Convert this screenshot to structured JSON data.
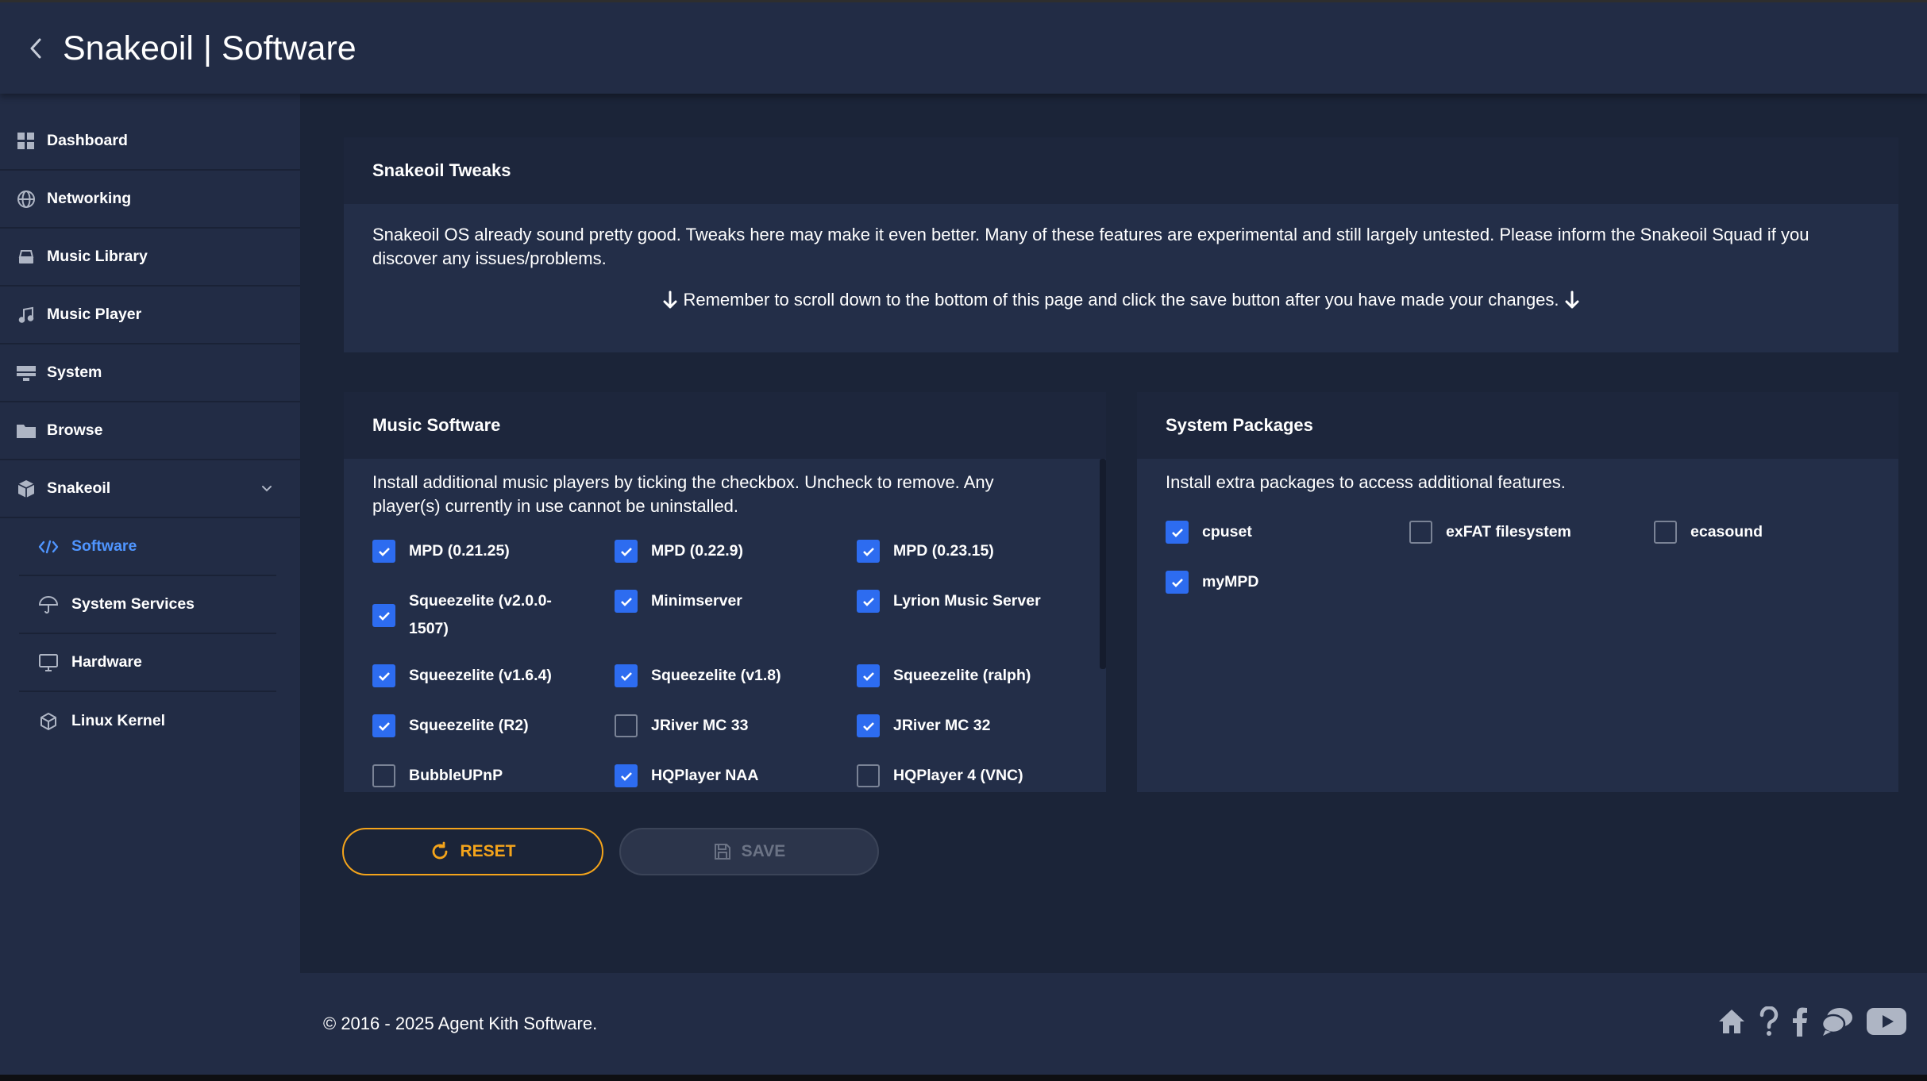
{
  "header": {
    "title": "Snakeoil | Software"
  },
  "sidebar": {
    "items": [
      {
        "label": "Dashboard",
        "icon": "dashboard-icon"
      },
      {
        "label": "Networking",
        "icon": "globe-icon"
      },
      {
        "label": "Music Library",
        "icon": "library-icon"
      },
      {
        "label": "Music Player",
        "icon": "music-note-icon"
      },
      {
        "label": "System",
        "icon": "system-icon"
      },
      {
        "label": "Browse",
        "icon": "folder-icon"
      },
      {
        "label": "Snakeoil",
        "icon": "package-icon"
      }
    ],
    "subitems": [
      {
        "label": "Software",
        "icon": "code-icon",
        "active": true
      },
      {
        "label": "System Services",
        "icon": "umbrella-icon"
      },
      {
        "label": "Hardware",
        "icon": "monitor-icon"
      },
      {
        "label": "Linux Kernel",
        "icon": "cube-icon"
      }
    ]
  },
  "tweaks": {
    "title": "Snakeoil Tweaks",
    "description": "Snakeoil OS already sound pretty good. Tweaks here may make it even better. Many of these features are experimental and still largely untested. Please inform the Snakeoil Squad if you discover any issues/problems.",
    "reminder": "Remember to scroll down to the bottom of this page and click the save button after you have made your changes."
  },
  "music_software": {
    "title": "Music Software",
    "description": "Install additional music players by ticking the checkbox. Uncheck to remove. Any player(s) currently in use cannot be uninstalled.",
    "options": [
      {
        "label": "MPD (0.21.25)",
        "checked": true
      },
      {
        "label": "MPD (0.22.9)",
        "checked": true
      },
      {
        "label": "MPD (0.23.15)",
        "checked": true
      },
      {
        "label": "Squeezelite (v2.0.0-1507)",
        "checked": true
      },
      {
        "label": "Minimserver",
        "checked": true
      },
      {
        "label": "Lyrion Music Server",
        "checked": true
      },
      {
        "label": "Squeezelite (v1.6.4)",
        "checked": true
      },
      {
        "label": "Squeezelite (v1.8)",
        "checked": true
      },
      {
        "label": "Squeezelite (ralph)",
        "checked": true
      },
      {
        "label": "Squeezelite (R2)",
        "checked": true
      },
      {
        "label": "JRiver MC 33",
        "checked": false
      },
      {
        "label": "JRiver MC 32",
        "checked": true
      },
      {
        "label": "BubbleUPnP",
        "checked": false
      },
      {
        "label": "HQPlayer NAA",
        "checked": true
      },
      {
        "label": "HQPlayer 4 (VNC)",
        "checked": false
      }
    ]
  },
  "system_packages": {
    "title": "System Packages",
    "description": "Install extra packages to access additional features.",
    "options": [
      {
        "label": "cpuset",
        "checked": true
      },
      {
        "label": "exFAT filesystem",
        "checked": false
      },
      {
        "label": "ecasound",
        "checked": false
      },
      {
        "label": "myMPD",
        "checked": true
      }
    ]
  },
  "buttons": {
    "reset": "RESET",
    "save": "SAVE"
  },
  "footer": {
    "copyright": "© 2016 - 2025 Agent Kith Software."
  },
  "colors": {
    "accent": "#2d6cf0",
    "active_nav": "#4f95ff",
    "reset": "#f4a41b"
  }
}
